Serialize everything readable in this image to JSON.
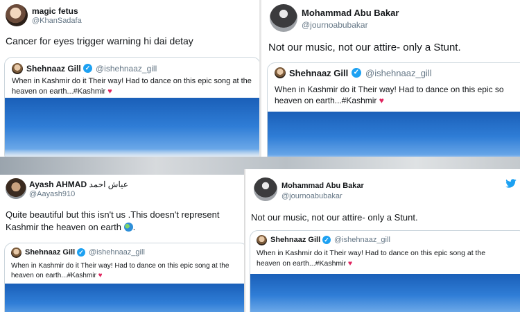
{
  "tweets": [
    {
      "name": "magic fetus",
      "handle": "@KhanSadafa",
      "text_lines": [
        "Cancer for eyes trigger warning hi dai detay"
      ]
    },
    {
      "name": "Mohammad Abu Bakar",
      "handle": "@journoabubakar",
      "text_lines": [
        "Not our music, not our attire- only a Stunt."
      ]
    },
    {
      "name_latin": "Ayash AHMAD",
      "name_arabic": "عیاش احمد",
      "handle": "@Aayash910",
      "text_lines": [
        "Quite beautiful but this isn't us .This doesn't represent",
        "Kashmir the heaven on earth",
        "."
      ],
      "globe_icon": "globe-icon"
    },
    {
      "name": "Mohammad Abu Bakar",
      "handle": "@journoabubakar",
      "text_lines": [
        "Not our music, not our attire- only a Stunt."
      ]
    }
  ],
  "quoted": {
    "name": "Shehnaaz Gill",
    "handle": "@ishehnaaz_gill",
    "verified_mark": "✓",
    "line1": "When in Kashmir do it Their way! Had to dance on this epic song at the",
    "line1_short": "When in Kashmir do it Their way! Had to dance on this epic so",
    "line2": "heaven on earth...#Kashmir",
    "heart": "♥"
  },
  "colors": {
    "link_blue": "#1da1f2",
    "heart_red": "#e0245e",
    "handle_gray": "#657786",
    "sky_blue": "#1a5fb8"
  }
}
